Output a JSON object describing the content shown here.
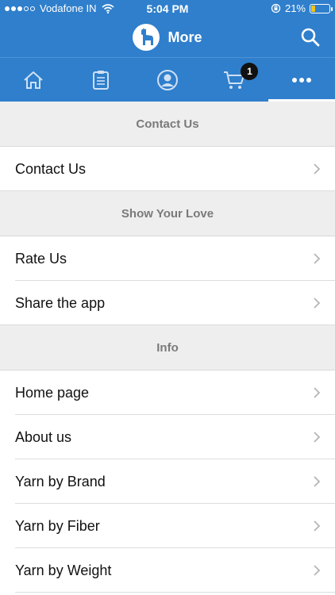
{
  "status_bar": {
    "carrier": "Vodafone IN",
    "time": "5:04 PM",
    "battery": "21%",
    "battery_level": 0.21,
    "signal_bars": 3
  },
  "header": {
    "title": "More",
    "logo_icon": "alpaca-logo-icon",
    "search_icon": "search-icon"
  },
  "tabs": [
    {
      "icon": "home-icon",
      "active": false
    },
    {
      "icon": "clipboard-icon",
      "active": false
    },
    {
      "icon": "user-icon",
      "active": false
    },
    {
      "icon": "cart-icon",
      "active": false,
      "badge": "1"
    },
    {
      "icon": "more-dots-icon",
      "active": true
    }
  ],
  "sections": [
    {
      "title": "Contact Us",
      "items": [
        "Contact Us"
      ]
    },
    {
      "title": "Show Your Love",
      "items": [
        "Rate Us",
        "Share the app"
      ]
    },
    {
      "title": "Info",
      "items": [
        "Home page",
        "About us",
        "Yarn by Brand",
        "Yarn by Fiber",
        "Yarn by Weight"
      ]
    }
  ],
  "colors": {
    "brand": "#2f7fcc",
    "section_bg": "#eeeeee",
    "section_text": "#7a7a7a"
  }
}
